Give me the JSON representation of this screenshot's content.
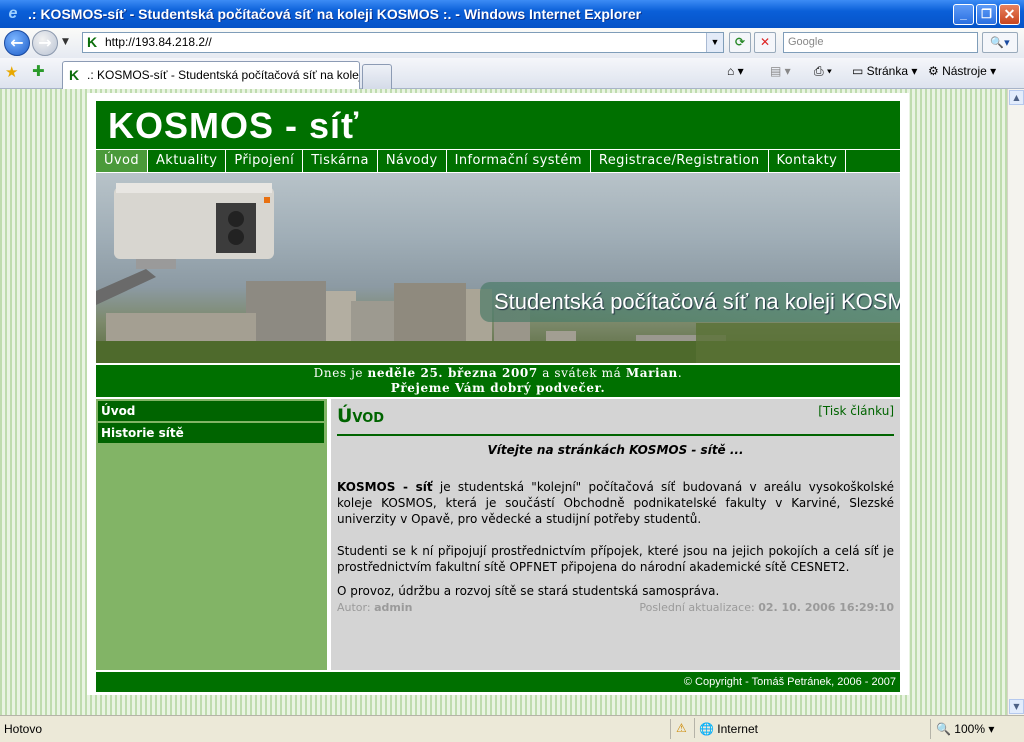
{
  "window": {
    "title": ".: KOSMOS-síť - Studentská počítačová síť na koleji KOSMOS :. - Windows Internet Explorer"
  },
  "toolbar": {
    "address": "http://193.84.218.2//",
    "search_placeholder": "Google",
    "tab_title": ".: KOSMOS-síť - Studentská počítačová síť na koleji K...",
    "page_menu": "Stránka",
    "tools_menu": "Nástroje"
  },
  "site": {
    "logo": "KOSMOS - síť",
    "menu": [
      "Úvod",
      "Aktuality",
      "Připojení",
      "Tiskárna",
      "Návody",
      "Informační systém",
      "Registrace/Registration",
      "Kontakty"
    ],
    "banner_text": "Studentská počítačová síť na koleji KOSMOS",
    "date_line1_pre": "Dnes je ",
    "date_day": "neděle 25. března 2007",
    "date_line1_mid": " a svátek má ",
    "date_name": "Marian",
    "date_line1_end": ".",
    "date_line2": "Přejeme Vám dobrý podvečer.",
    "sidebar": [
      "Úvod",
      "Historie sítě"
    ],
    "content": {
      "heading": "Úvod",
      "print": "[Tisk článku]",
      "welcome": "Vítejte na stránkách KOSMOS - sítě ...",
      "p1_bold": "KOSMOS - síť",
      "p1": " je studentská \"kolejní\" počítačová síť budovaná v areálu vysokoškolské koleje KOSMOS, která je součástí Obchodně podnikatelské fakulty v Karviné, Slezské univerzity v Opavě, pro vědecké a studijní potřeby studentů.",
      "p2": "Studenti se k ní připojují prostřednictvím přípojek, které jsou na jejich pokojích a celá síť je prostřednictvím fakultní sítě OPFNET připojena do národní akademické sítě CESNET2.",
      "p3": "O provoz, údržbu a rozvoj sítě se stará studentská samospráva.",
      "author_label": "Autor: ",
      "author": "admin",
      "updated_label": "Poslední aktualizace: ",
      "updated": "02. 10. 2006 16:29:10"
    },
    "footer": "© Copyright - Tomáš Petránek, 2006 - 2007"
  },
  "statusbar": {
    "status": "Hotovo",
    "zone": "Internet",
    "zoom": "100%"
  }
}
